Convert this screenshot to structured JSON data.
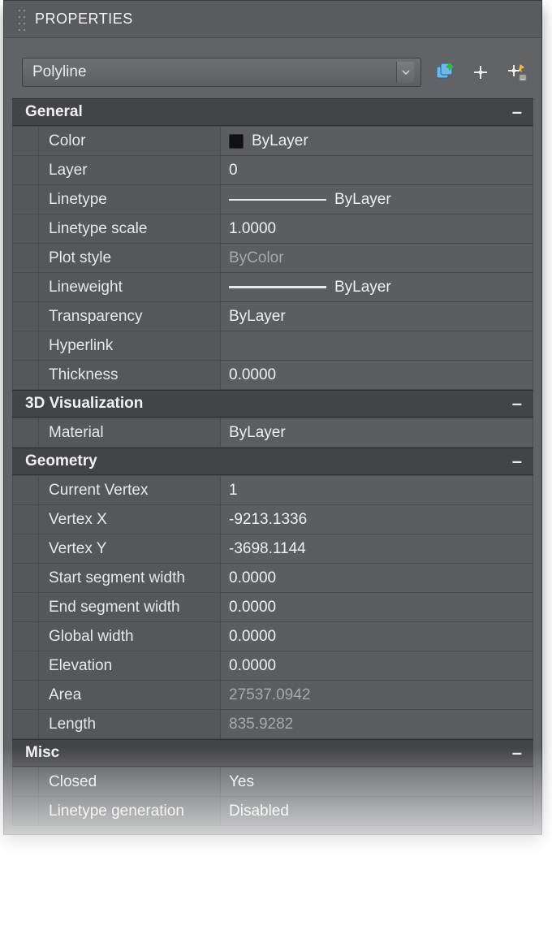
{
  "panel_title": "PROPERTIES",
  "object_type": "Polyline",
  "sections": {
    "general": {
      "title": "General",
      "rows": {
        "color": {
          "label": "Color",
          "value": "ByLayer"
        },
        "layer": {
          "label": "Layer",
          "value": "0"
        },
        "linetype": {
          "label": "Linetype",
          "value": "ByLayer"
        },
        "ltscale": {
          "label": "Linetype scale",
          "value": "1.0000"
        },
        "plotstyle": {
          "label": "Plot style",
          "value": "ByColor"
        },
        "lineweight": {
          "label": "Lineweight",
          "value": "ByLayer"
        },
        "transparency": {
          "label": "Transparency",
          "value": "ByLayer"
        },
        "hyperlink": {
          "label": "Hyperlink",
          "value": ""
        },
        "thickness": {
          "label": "Thickness",
          "value": "0.0000"
        }
      }
    },
    "viz": {
      "title": "3D Visualization",
      "rows": {
        "material": {
          "label": "Material",
          "value": "ByLayer"
        }
      }
    },
    "geometry": {
      "title": "Geometry",
      "rows": {
        "curvtx": {
          "label": "Current Vertex",
          "value": "1"
        },
        "vx": {
          "label": "Vertex X",
          "value": "-9213.1336"
        },
        "vy": {
          "label": "Vertex Y",
          "value": "-3698.1144"
        },
        "ssw": {
          "label": "Start segment width",
          "value": "0.0000"
        },
        "esw": {
          "label": "End segment width",
          "value": "0.0000"
        },
        "gw": {
          "label": "Global width",
          "value": "0.0000"
        },
        "elev": {
          "label": "Elevation",
          "value": "0.0000"
        },
        "area": {
          "label": "Area",
          "value": "27537.0942"
        },
        "length": {
          "label": "Length",
          "value": "835.9282"
        }
      }
    },
    "misc": {
      "title": "Misc",
      "rows": {
        "closed": {
          "label": "Closed",
          "value": "Yes"
        },
        "ltgen": {
          "label": "Linetype generation",
          "value": "Disabled"
        }
      }
    }
  },
  "collapse_glyph": "–"
}
